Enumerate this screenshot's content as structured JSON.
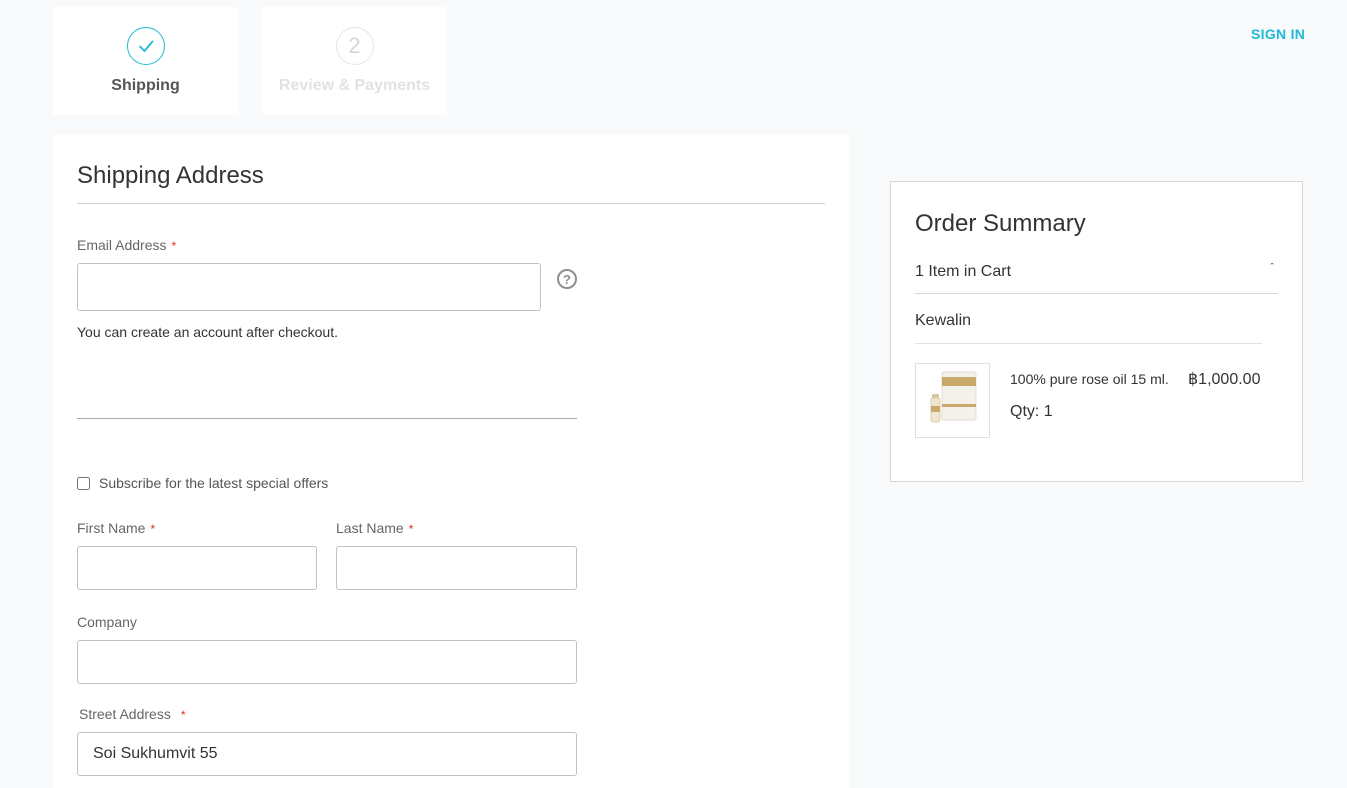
{
  "progress": {
    "steps": [
      {
        "label": "Shipping",
        "state": "complete",
        "icon": "check-icon"
      },
      {
        "label": "Review & Payments",
        "number": "2",
        "state": "upcoming"
      }
    ]
  },
  "header": {
    "sign_in": "SIGN IN"
  },
  "shipping": {
    "title": "Shipping Address",
    "email": {
      "label": "Email Address",
      "value": "",
      "help_icon": "question-circle-icon"
    },
    "email_note": "You can create an account after checkout.",
    "subscribe_label": "Subscribe for the latest special offers",
    "first_name": {
      "label": "First Name",
      "value": ""
    },
    "last_name": {
      "label": "Last Name",
      "value": ""
    },
    "company": {
      "label": "Company",
      "value": ""
    },
    "street": {
      "label": "Street Address",
      "value": "Soi Sukhumvit 55"
    },
    "required_mark": "*"
  },
  "summary": {
    "title": "Order Summary",
    "items_in_cart": "1 Item in Cart",
    "seller": "Kewalin",
    "item": {
      "name": "100% pure rose oil 15 ml.",
      "price": "฿1,000.00",
      "qty": "Qty: 1"
    }
  },
  "colors": {
    "accent": "#1fb9d6",
    "required": "#e02b27"
  }
}
